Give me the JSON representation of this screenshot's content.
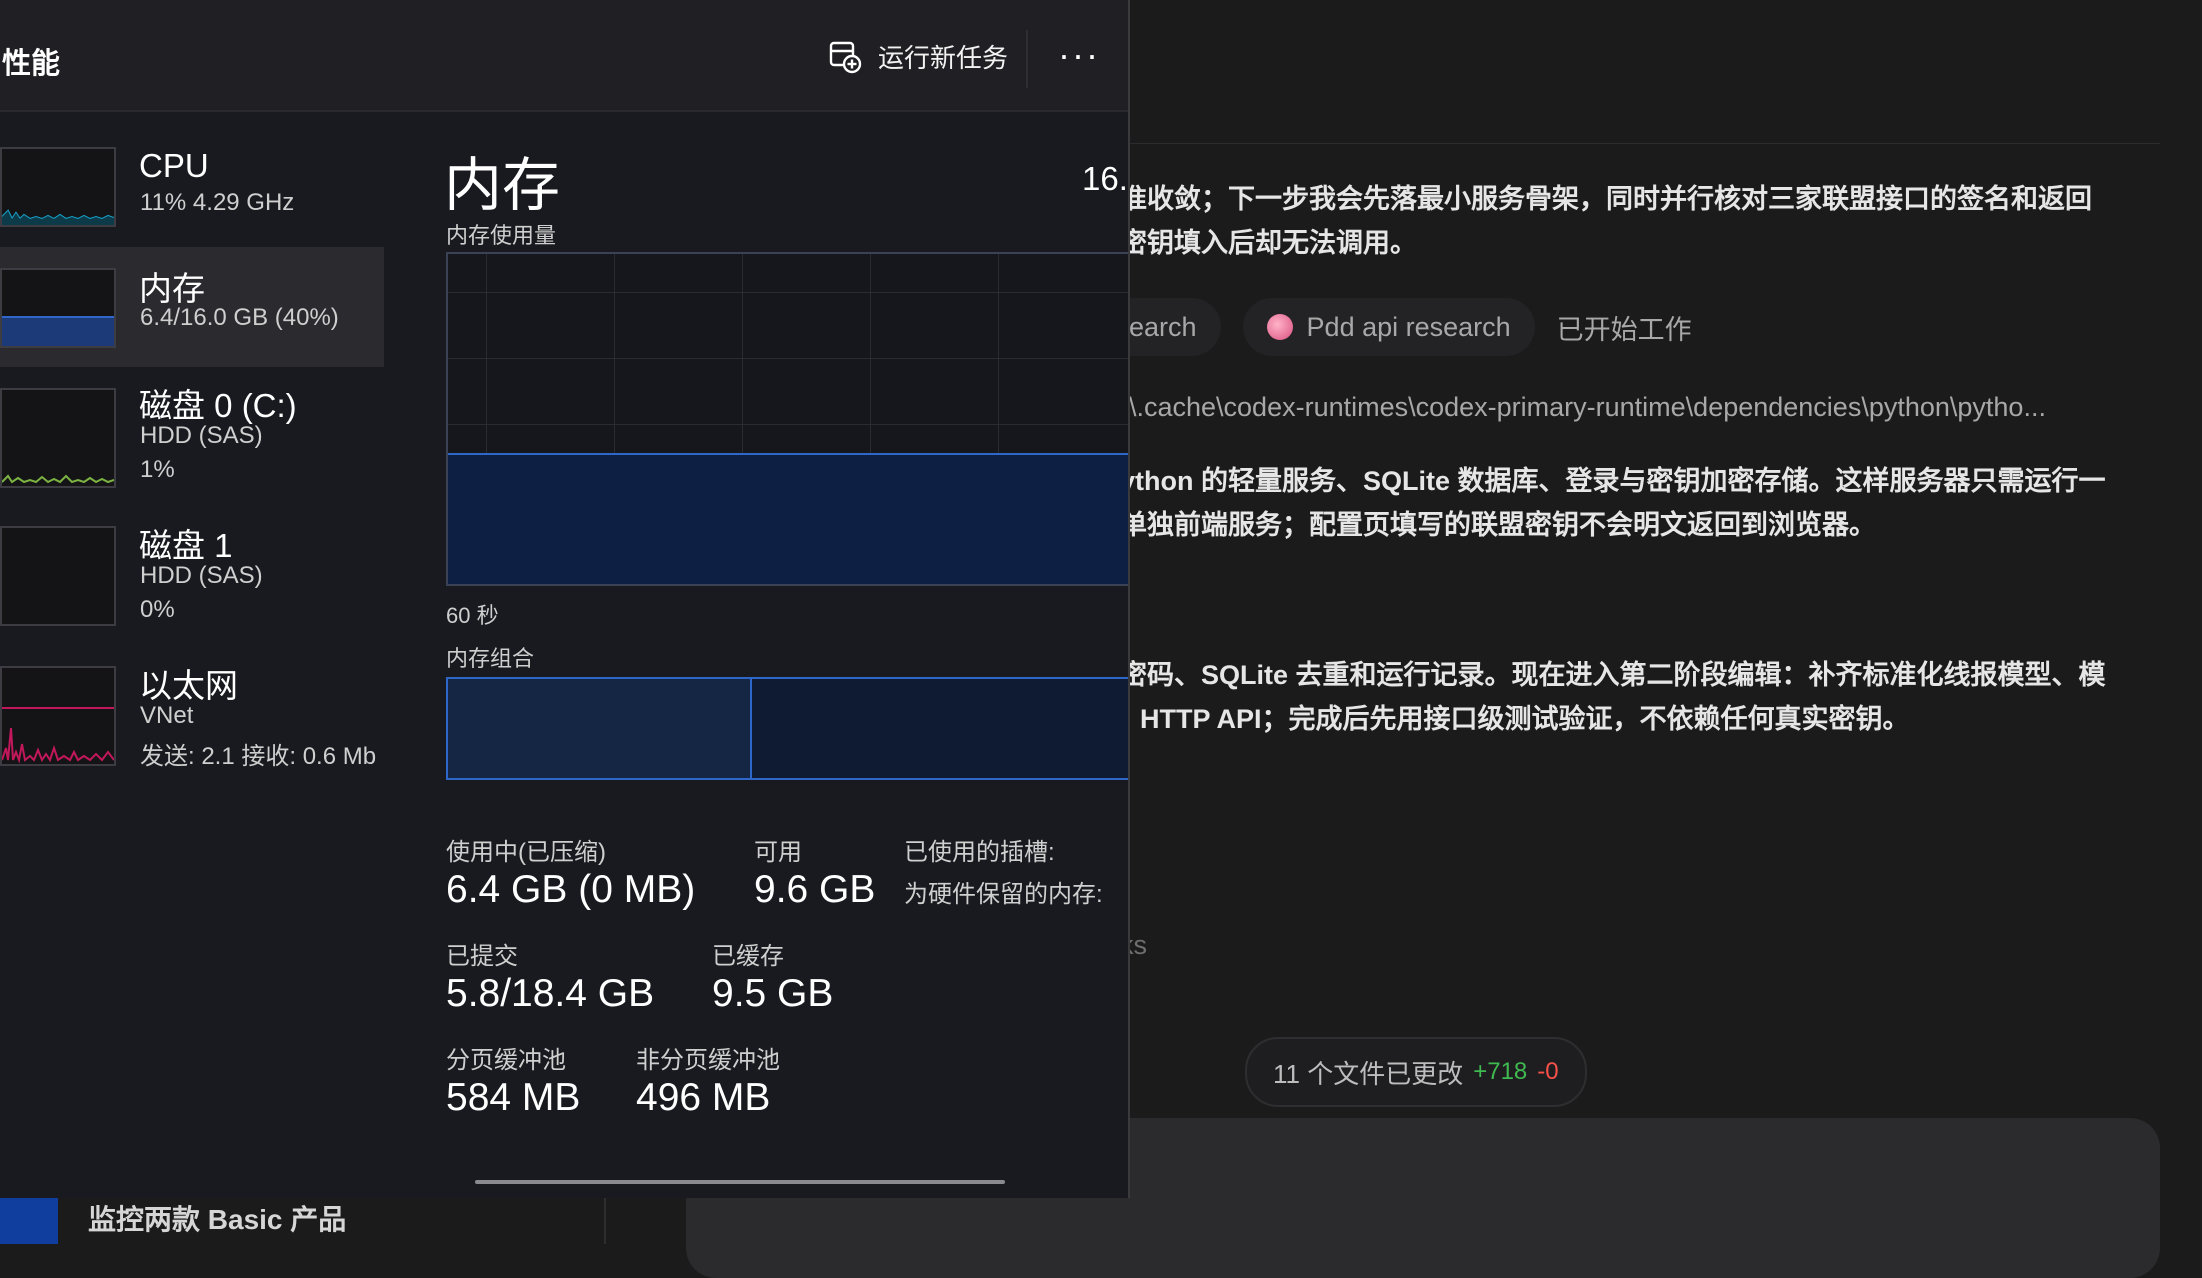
{
  "background_chat": {
    "message_1_lines": [
      "准收敛；下一步我会先落最小服务骨架，同时并行核对三家联盟接口的签名和返回",
      "密钥填入后却无法调用。"
    ],
    "chip_partial": "earch",
    "chip_name": "Pdd api research",
    "chip_status": "已开始工作",
    "path": "r\\.cache\\codex-runtimes\\codex-primary-runtime\\dependencies\\python\\pytho...",
    "message_2_lines": [
      "ython 的轻量服务、SQLite 数据库、登录与密钥加密存储。这样服务器只需运行一",
      "单独前端服务；配置页填写的联盟密钥不会明文返回到浏览器。"
    ],
    "message_3_lines": [
      "密码、SQLite 去重和运行记录。现在进入第二阶段编辑：补齐标准化线报模型、模",
      "HTTP API；完成后先用接口级测试验证，不依赖任何真实密钥。"
    ],
    "faint_text": "ks",
    "changes_pill": {
      "label": "11 个文件已更改",
      "added": "+718",
      "removed": "-0"
    },
    "bottom_item": "监控两款 Basic 产品"
  },
  "task_manager": {
    "title": "性能",
    "run_new_task": "运行新任务",
    "more_label": "···",
    "sidebar": [
      {
        "name": "CPU",
        "line2": "11%  4.29 GHz",
        "line3": "",
        "color": "#17a2c8"
      },
      {
        "name": "内存",
        "line2": "6.4/16.0 GB (40%)",
        "line3": "",
        "color": "#2f67c9"
      },
      {
        "name": "磁盘 0 (C:)",
        "line2": "HDD (SAS)",
        "line3": "1%",
        "color": "#7cb342"
      },
      {
        "name": "磁盘 1",
        "line2": "HDD (SAS)",
        "line3": "0%",
        "color": "#7cb342"
      },
      {
        "name": "以太网",
        "line2": "VNet",
        "line3": "发送: 2.1  接收: 0.6 Mb",
        "color": "#c2185b"
      }
    ],
    "memory": {
      "title": "内存",
      "total_partial": "16.",
      "usage_label": "内存使用量",
      "time_label": "60 秒",
      "composition_label": "内存组合",
      "usage_level": 0.39,
      "stats": {
        "in_use_label": "使用中(已压缩)",
        "in_use_value": "6.4 GB (0 MB)",
        "available_label": "可用",
        "available_value": "9.6 GB",
        "slots_label": "已使用的插槽:",
        "reserved_label": "为硬件保留的内存:",
        "committed_label": "已提交",
        "committed_value": "5.8/18.4 GB",
        "cached_label": "已缓存",
        "cached_value": "9.5 GB",
        "paged_label": "分页缓冲池",
        "paged_value": "584 MB",
        "nonpaged_label": "非分页缓冲池",
        "nonpaged_value": "496 MB"
      }
    }
  }
}
